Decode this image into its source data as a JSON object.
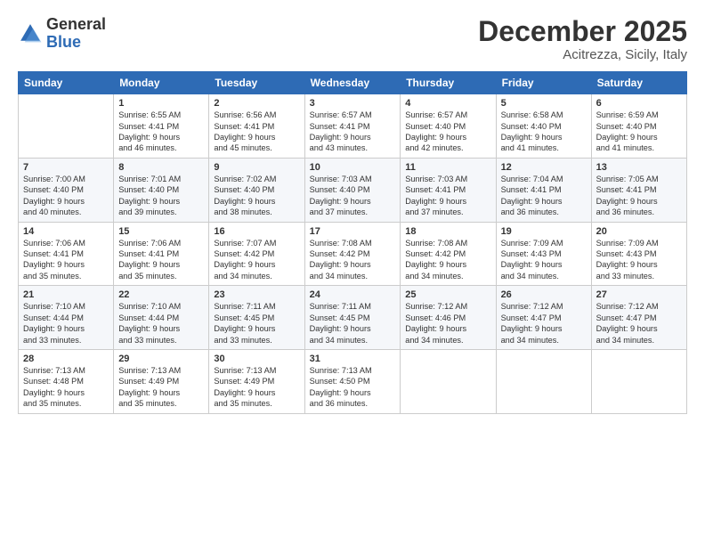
{
  "logo": {
    "general": "General",
    "blue": "Blue"
  },
  "header": {
    "month": "December 2025",
    "location": "Acitrezza, Sicily, Italy"
  },
  "weekdays": [
    "Sunday",
    "Monday",
    "Tuesday",
    "Wednesday",
    "Thursday",
    "Friday",
    "Saturday"
  ],
  "weeks": [
    [
      {
        "day": "",
        "info": ""
      },
      {
        "day": "1",
        "info": "Sunrise: 6:55 AM\nSunset: 4:41 PM\nDaylight: 9 hours\nand 46 minutes."
      },
      {
        "day": "2",
        "info": "Sunrise: 6:56 AM\nSunset: 4:41 PM\nDaylight: 9 hours\nand 45 minutes."
      },
      {
        "day": "3",
        "info": "Sunrise: 6:57 AM\nSunset: 4:41 PM\nDaylight: 9 hours\nand 43 minutes."
      },
      {
        "day": "4",
        "info": "Sunrise: 6:57 AM\nSunset: 4:40 PM\nDaylight: 9 hours\nand 42 minutes."
      },
      {
        "day": "5",
        "info": "Sunrise: 6:58 AM\nSunset: 4:40 PM\nDaylight: 9 hours\nand 41 minutes."
      },
      {
        "day": "6",
        "info": "Sunrise: 6:59 AM\nSunset: 4:40 PM\nDaylight: 9 hours\nand 41 minutes."
      }
    ],
    [
      {
        "day": "7",
        "info": ""
      },
      {
        "day": "8",
        "info": "Sunrise: 7:01 AM\nSunset: 4:40 PM\nDaylight: 9 hours\nand 39 minutes."
      },
      {
        "day": "9",
        "info": "Sunrise: 7:02 AM\nSunset: 4:40 PM\nDaylight: 9 hours\nand 38 minutes."
      },
      {
        "day": "10",
        "info": "Sunrise: 7:03 AM\nSunset: 4:40 PM\nDaylight: 9 hours\nand 37 minutes."
      },
      {
        "day": "11",
        "info": "Sunrise: 7:03 AM\nSunset: 4:41 PM\nDaylight: 9 hours\nand 37 minutes."
      },
      {
        "day": "12",
        "info": "Sunrise: 7:04 AM\nSunset: 4:41 PM\nDaylight: 9 hours\nand 36 minutes."
      },
      {
        "day": "13",
        "info": "Sunrise: 7:05 AM\nSunset: 4:41 PM\nDaylight: 9 hours\nand 36 minutes."
      }
    ],
    [
      {
        "day": "14",
        "info": ""
      },
      {
        "day": "15",
        "info": "Sunrise: 7:06 AM\nSunset: 4:41 PM\nDaylight: 9 hours\nand 35 minutes."
      },
      {
        "day": "16",
        "info": "Sunrise: 7:07 AM\nSunset: 4:42 PM\nDaylight: 9 hours\nand 34 minutes."
      },
      {
        "day": "17",
        "info": "Sunrise: 7:08 AM\nSunset: 4:42 PM\nDaylight: 9 hours\nand 34 minutes."
      },
      {
        "day": "18",
        "info": "Sunrise: 7:08 AM\nSunset: 4:42 PM\nDaylight: 9 hours\nand 34 minutes."
      },
      {
        "day": "19",
        "info": "Sunrise: 7:09 AM\nSunset: 4:43 PM\nDaylight: 9 hours\nand 34 minutes."
      },
      {
        "day": "20",
        "info": "Sunrise: 7:09 AM\nSunset: 4:43 PM\nDaylight: 9 hours\nand 33 minutes."
      }
    ],
    [
      {
        "day": "21",
        "info": ""
      },
      {
        "day": "22",
        "info": "Sunrise: 7:10 AM\nSunset: 4:44 PM\nDaylight: 9 hours\nand 33 minutes."
      },
      {
        "day": "23",
        "info": "Sunrise: 7:11 AM\nSunset: 4:45 PM\nDaylight: 9 hours\nand 33 minutes."
      },
      {
        "day": "24",
        "info": "Sunrise: 7:11 AM\nSunset: 4:45 PM\nDaylight: 9 hours\nand 34 minutes."
      },
      {
        "day": "25",
        "info": "Sunrise: 7:12 AM\nSunset: 4:46 PM\nDaylight: 9 hours\nand 34 minutes."
      },
      {
        "day": "26",
        "info": "Sunrise: 7:12 AM\nSunset: 4:47 PM\nDaylight: 9 hours\nand 34 minutes."
      },
      {
        "day": "27",
        "info": "Sunrise: 7:12 AM\nSunset: 4:47 PM\nDaylight: 9 hours\nand 34 minutes."
      }
    ],
    [
      {
        "day": "28",
        "info": "Sunrise: 7:13 AM\nSunset: 4:48 PM\nDaylight: 9 hours\nand 35 minutes."
      },
      {
        "day": "29",
        "info": "Sunrise: 7:13 AM\nSunset: 4:49 PM\nDaylight: 9 hours\nand 35 minutes."
      },
      {
        "day": "30",
        "info": "Sunrise: 7:13 AM\nSunset: 4:49 PM\nDaylight: 9 hours\nand 35 minutes."
      },
      {
        "day": "31",
        "info": "Sunrise: 7:13 AM\nSunset: 4:50 PM\nDaylight: 9 hours\nand 36 minutes."
      },
      {
        "day": "",
        "info": ""
      },
      {
        "day": "",
        "info": ""
      },
      {
        "day": "",
        "info": ""
      }
    ]
  ],
  "sunday_infos": {
    "7": "Sunrise: 7:00 AM\nSunset: 4:40 PM\nDaylight: 9 hours\nand 40 minutes.",
    "14": "Sunrise: 7:06 AM\nSunset: 4:41 PM\nDaylight: 9 hours\nand 35 minutes.",
    "21": "Sunrise: 7:10 AM\nSunset: 4:44 PM\nDaylight: 9 hours\nand 33 minutes."
  }
}
